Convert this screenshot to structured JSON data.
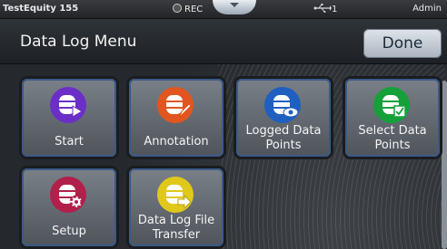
{
  "status": {
    "device": "TestEquity 155",
    "rec_label": "REC",
    "usb_label": "1",
    "user": "Admin"
  },
  "header": {
    "title": "Data Log Menu",
    "done_label": "Done"
  },
  "tiles": [
    {
      "label": "Start",
      "icon": "database-play-icon",
      "color": "#6b2fc7"
    },
    {
      "label": "Annotation",
      "icon": "database-pencil-icon",
      "color": "#e0561e"
    },
    {
      "label": "Logged Data Points",
      "icon": "database-eye-icon",
      "color": "#1f5fc0"
    },
    {
      "label": "Select Data Points",
      "icon": "database-checkbox-icon",
      "color": "#16a03a"
    },
    {
      "label": "Setup",
      "icon": "database-gear-icon",
      "color": "#b0204a"
    },
    {
      "label": "Data Log File Transfer",
      "icon": "database-export-icon",
      "color": "#e0c81a"
    }
  ]
}
